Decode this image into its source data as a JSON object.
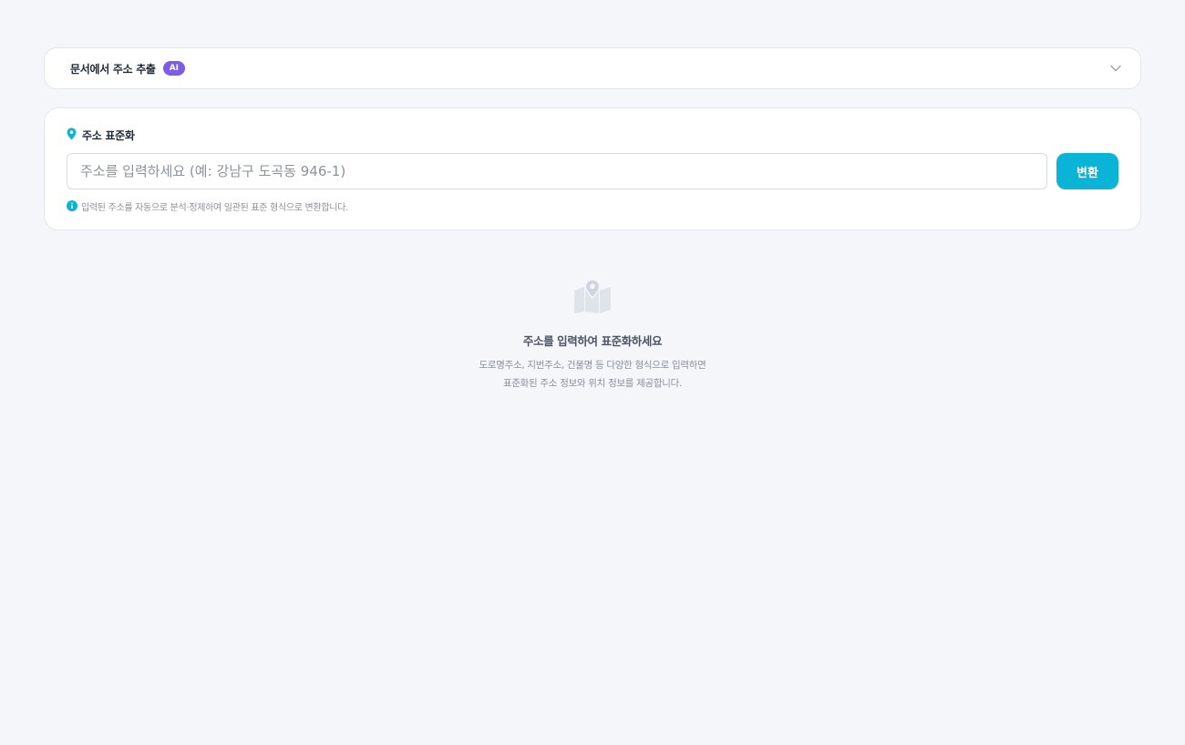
{
  "extract_section": {
    "title": "문서에서 주소 추출",
    "badge": "AI",
    "chevron_icon": "chevron-down-icon"
  },
  "standardize_section": {
    "title": "주소 표준화",
    "header_icon": "map-pin-icon",
    "input": {
      "value": "",
      "placeholder": "주소를 입력하세요 (예: 강남구 도곡동 946-1)"
    },
    "convert_label": "변환",
    "hint_icon": "info-icon",
    "hint": "입력된 주소를 자동으로 분석·정제하여 일관된 표준 형식으로 변환합니다."
  },
  "empty_state": {
    "icon": "map-location-icon",
    "title": "주소를 입력하여 표준화하세요",
    "description_line1": "도로명주소, 지번주소, 건물명 등 다양한 형식으로 입력하면",
    "description_line2": "표준화된 주소 정보와 위치 정보를 제공합니다."
  },
  "colors": {
    "accent": "#0ab4d6",
    "ai_badge": "#7c5ce8",
    "background": "#f5f6fa"
  }
}
